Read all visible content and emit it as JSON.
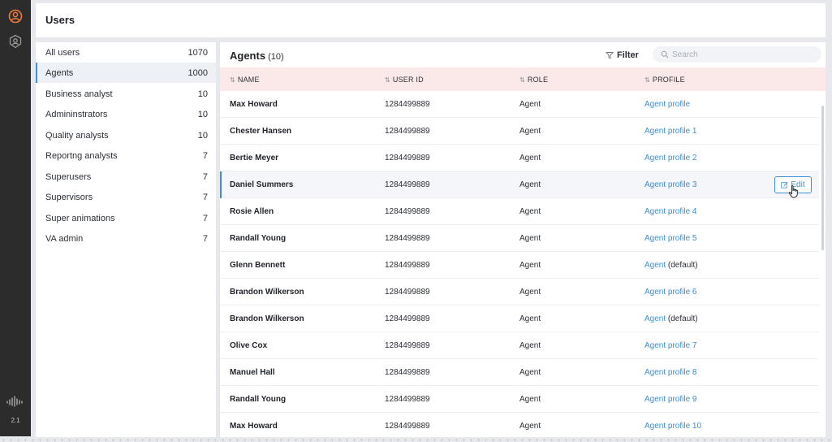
{
  "app": {
    "version": "2.1",
    "accent": "#3a8fd6",
    "brand_icon_color": "#f07a3a"
  },
  "header": {
    "title": "Users"
  },
  "categories": [
    {
      "label": "All users",
      "count": "1070"
    },
    {
      "label": "Agents",
      "count": "1000"
    },
    {
      "label": "Business analyst",
      "count": "10"
    },
    {
      "label": "Admininstrators",
      "count": "10"
    },
    {
      "label": "Quality analysts",
      "count": "10"
    },
    {
      "label": "Reportng analysts",
      "count": "7"
    },
    {
      "label": "Superusers",
      "count": "7"
    },
    {
      "label": "Supervisors",
      "count": "7"
    },
    {
      "label": "Super animations",
      "count": "7"
    },
    {
      "label": "VA admin",
      "count": "7"
    }
  ],
  "main": {
    "title": "Agents",
    "count": "(10)",
    "filter_label": "Filter",
    "search_placeholder": "Search",
    "columns": {
      "name": "NAME",
      "user_id": "USER ID",
      "role": "ROLE",
      "profile": "PROFILE"
    },
    "edit_label": "Edit",
    "rows": [
      {
        "name": "Max Howard",
        "user_id": "1284499889",
        "role": "Agent",
        "profile_link": "Agent profile",
        "profile_suffix": ""
      },
      {
        "name": "Chester Hansen",
        "user_id": "1284499889",
        "role": "Agent",
        "profile_link": "Agent profile 1",
        "profile_suffix": ""
      },
      {
        "name": "Bertie Meyer",
        "user_id": "1284499889",
        "role": "Agent",
        "profile_link": "Agent profile 2",
        "profile_suffix": ""
      },
      {
        "name": "Daniel Summers",
        "user_id": "1284499889",
        "role": "Agent",
        "profile_link": "Agent profile 3",
        "profile_suffix": ""
      },
      {
        "name": "Rosie Allen",
        "user_id": "1284499889",
        "role": "Agent",
        "profile_link": "Agent profile 4",
        "profile_suffix": ""
      },
      {
        "name": "Randall Young",
        "user_id": "1284499889",
        "role": "Agent",
        "profile_link": "Agent profile 5",
        "profile_suffix": ""
      },
      {
        "name": "Glenn Bennett",
        "user_id": "1284499889",
        "role": "Agent",
        "profile_link": "Agent",
        "profile_suffix": " (default)"
      },
      {
        "name": "Brandon Wilkerson",
        "user_id": "1284499889",
        "role": "Agent",
        "profile_link": "Agent profile 6",
        "profile_suffix": ""
      },
      {
        "name": "Brandon Wilkerson",
        "user_id": "1284499889",
        "role": "Agent",
        "profile_link": "Agent",
        "profile_suffix": " (default)"
      },
      {
        "name": "Olive Cox",
        "user_id": "1284499889",
        "role": "Agent",
        "profile_link": "Agent profile 7",
        "profile_suffix": ""
      },
      {
        "name": "Manuel Hall",
        "user_id": "1284499889",
        "role": "Agent",
        "profile_link": "Agent profile 8",
        "profile_suffix": ""
      },
      {
        "name": "Randall Young",
        "user_id": "1284499889",
        "role": "Agent",
        "profile_link": "Agent profile 9",
        "profile_suffix": ""
      },
      {
        "name": "Max Howard",
        "user_id": "1284499889",
        "role": "Agent",
        "profile_link": "Agent profile 10",
        "profile_suffix": ""
      }
    ]
  }
}
